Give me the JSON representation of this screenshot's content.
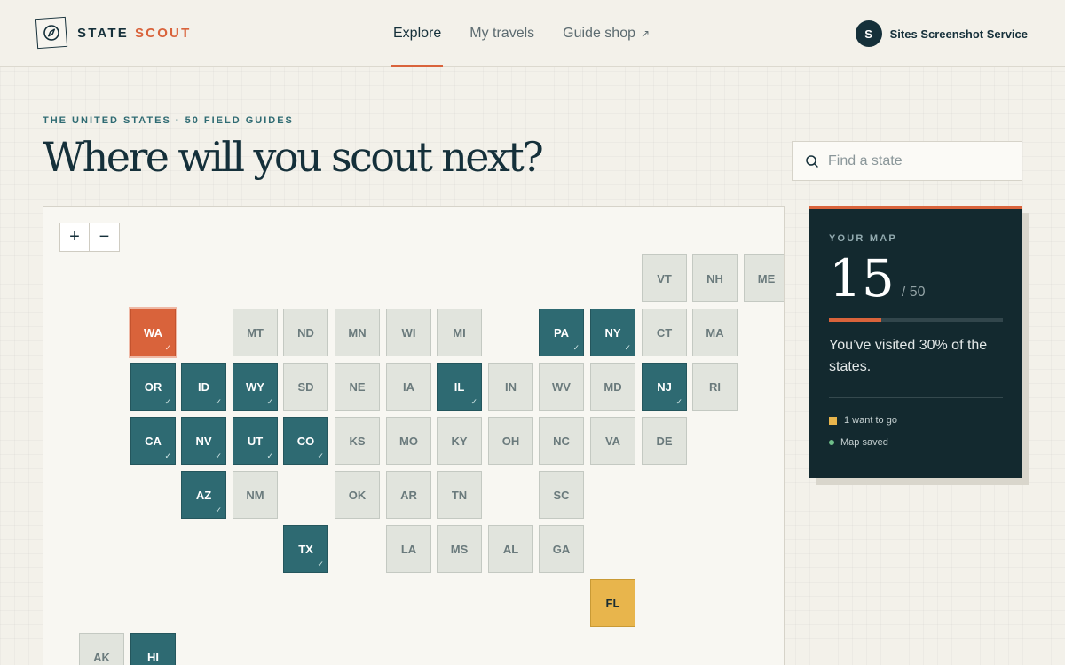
{
  "header": {
    "brand_first": "STATE",
    "brand_second": "SCOUT",
    "nav": [
      {
        "label": "Explore",
        "active": true
      },
      {
        "label": "My travels",
        "active": false
      },
      {
        "label": "Guide shop",
        "active": false,
        "external": true
      }
    ],
    "external_icon": "↗",
    "avatar_initial": "S",
    "account_name": "Sites Screenshot Service"
  },
  "hero": {
    "eyebrow": "THE UNITED STATES · 50 FIELD GUIDES",
    "title": "Where will you scout next?"
  },
  "search": {
    "placeholder": "Find a state",
    "value": ""
  },
  "map": {
    "zoom_in": "+",
    "zoom_out": "−",
    "check_glyph": "✓",
    "states": [
      {
        "abbr": "VT",
        "status": "none"
      },
      {
        "abbr": "NH",
        "status": "none"
      },
      {
        "abbr": "ME",
        "status": "none"
      },
      {
        "abbr": "WA",
        "status": "current"
      },
      {
        "abbr": "MT",
        "status": "none"
      },
      {
        "abbr": "ND",
        "status": "none"
      },
      {
        "abbr": "MN",
        "status": "none"
      },
      {
        "abbr": "WI",
        "status": "none"
      },
      {
        "abbr": "MI",
        "status": "none"
      },
      {
        "abbr": "PA",
        "status": "visited"
      },
      {
        "abbr": "NY",
        "status": "visited"
      },
      {
        "abbr": "CT",
        "status": "none"
      },
      {
        "abbr": "MA",
        "status": "none"
      },
      {
        "abbr": "OR",
        "status": "visited"
      },
      {
        "abbr": "ID",
        "status": "visited"
      },
      {
        "abbr": "WY",
        "status": "visited"
      },
      {
        "abbr": "SD",
        "status": "none"
      },
      {
        "abbr": "NE",
        "status": "none"
      },
      {
        "abbr": "IA",
        "status": "none"
      },
      {
        "abbr": "IL",
        "status": "visited"
      },
      {
        "abbr": "IN",
        "status": "none"
      },
      {
        "abbr": "WV",
        "status": "none"
      },
      {
        "abbr": "MD",
        "status": "none"
      },
      {
        "abbr": "NJ",
        "status": "visited"
      },
      {
        "abbr": "RI",
        "status": "none"
      },
      {
        "abbr": "CA",
        "status": "visited"
      },
      {
        "abbr": "NV",
        "status": "visited"
      },
      {
        "abbr": "UT",
        "status": "visited"
      },
      {
        "abbr": "CO",
        "status": "visited"
      },
      {
        "abbr": "KS",
        "status": "none"
      },
      {
        "abbr": "MO",
        "status": "none"
      },
      {
        "abbr": "KY",
        "status": "none"
      },
      {
        "abbr": "OH",
        "status": "none"
      },
      {
        "abbr": "NC",
        "status": "none"
      },
      {
        "abbr": "VA",
        "status": "none"
      },
      {
        "abbr": "DE",
        "status": "none"
      },
      {
        "abbr": "AZ",
        "status": "visited"
      },
      {
        "abbr": "NM",
        "status": "none"
      },
      {
        "abbr": "OK",
        "status": "none"
      },
      {
        "abbr": "AR",
        "status": "none"
      },
      {
        "abbr": "TN",
        "status": "none"
      },
      {
        "abbr": "SC",
        "status": "none"
      },
      {
        "abbr": "TX",
        "status": "visited"
      },
      {
        "abbr": "LA",
        "status": "none"
      },
      {
        "abbr": "MS",
        "status": "none"
      },
      {
        "abbr": "AL",
        "status": "none"
      },
      {
        "abbr": "GA",
        "status": "none"
      },
      {
        "abbr": "FL",
        "status": "want"
      },
      {
        "abbr": "AK",
        "status": "none"
      },
      {
        "abbr": "HI",
        "status": "visited"
      }
    ]
  },
  "stats": {
    "label": "YOUR MAP",
    "visited": "15",
    "total": "/ 50",
    "progress_fraction": 0.3,
    "summary": "You’ve visited 30% of the states.",
    "legend_want": "1 want to go",
    "legend_saved": "Map saved"
  },
  "colors": {
    "accent": "#d9633b",
    "visited": "#2e6a72",
    "want": "#e8b54c",
    "unvisited": "#e1e4dd",
    "card_bg": "#13292f",
    "saved_dot": "#6fbf8a"
  }
}
